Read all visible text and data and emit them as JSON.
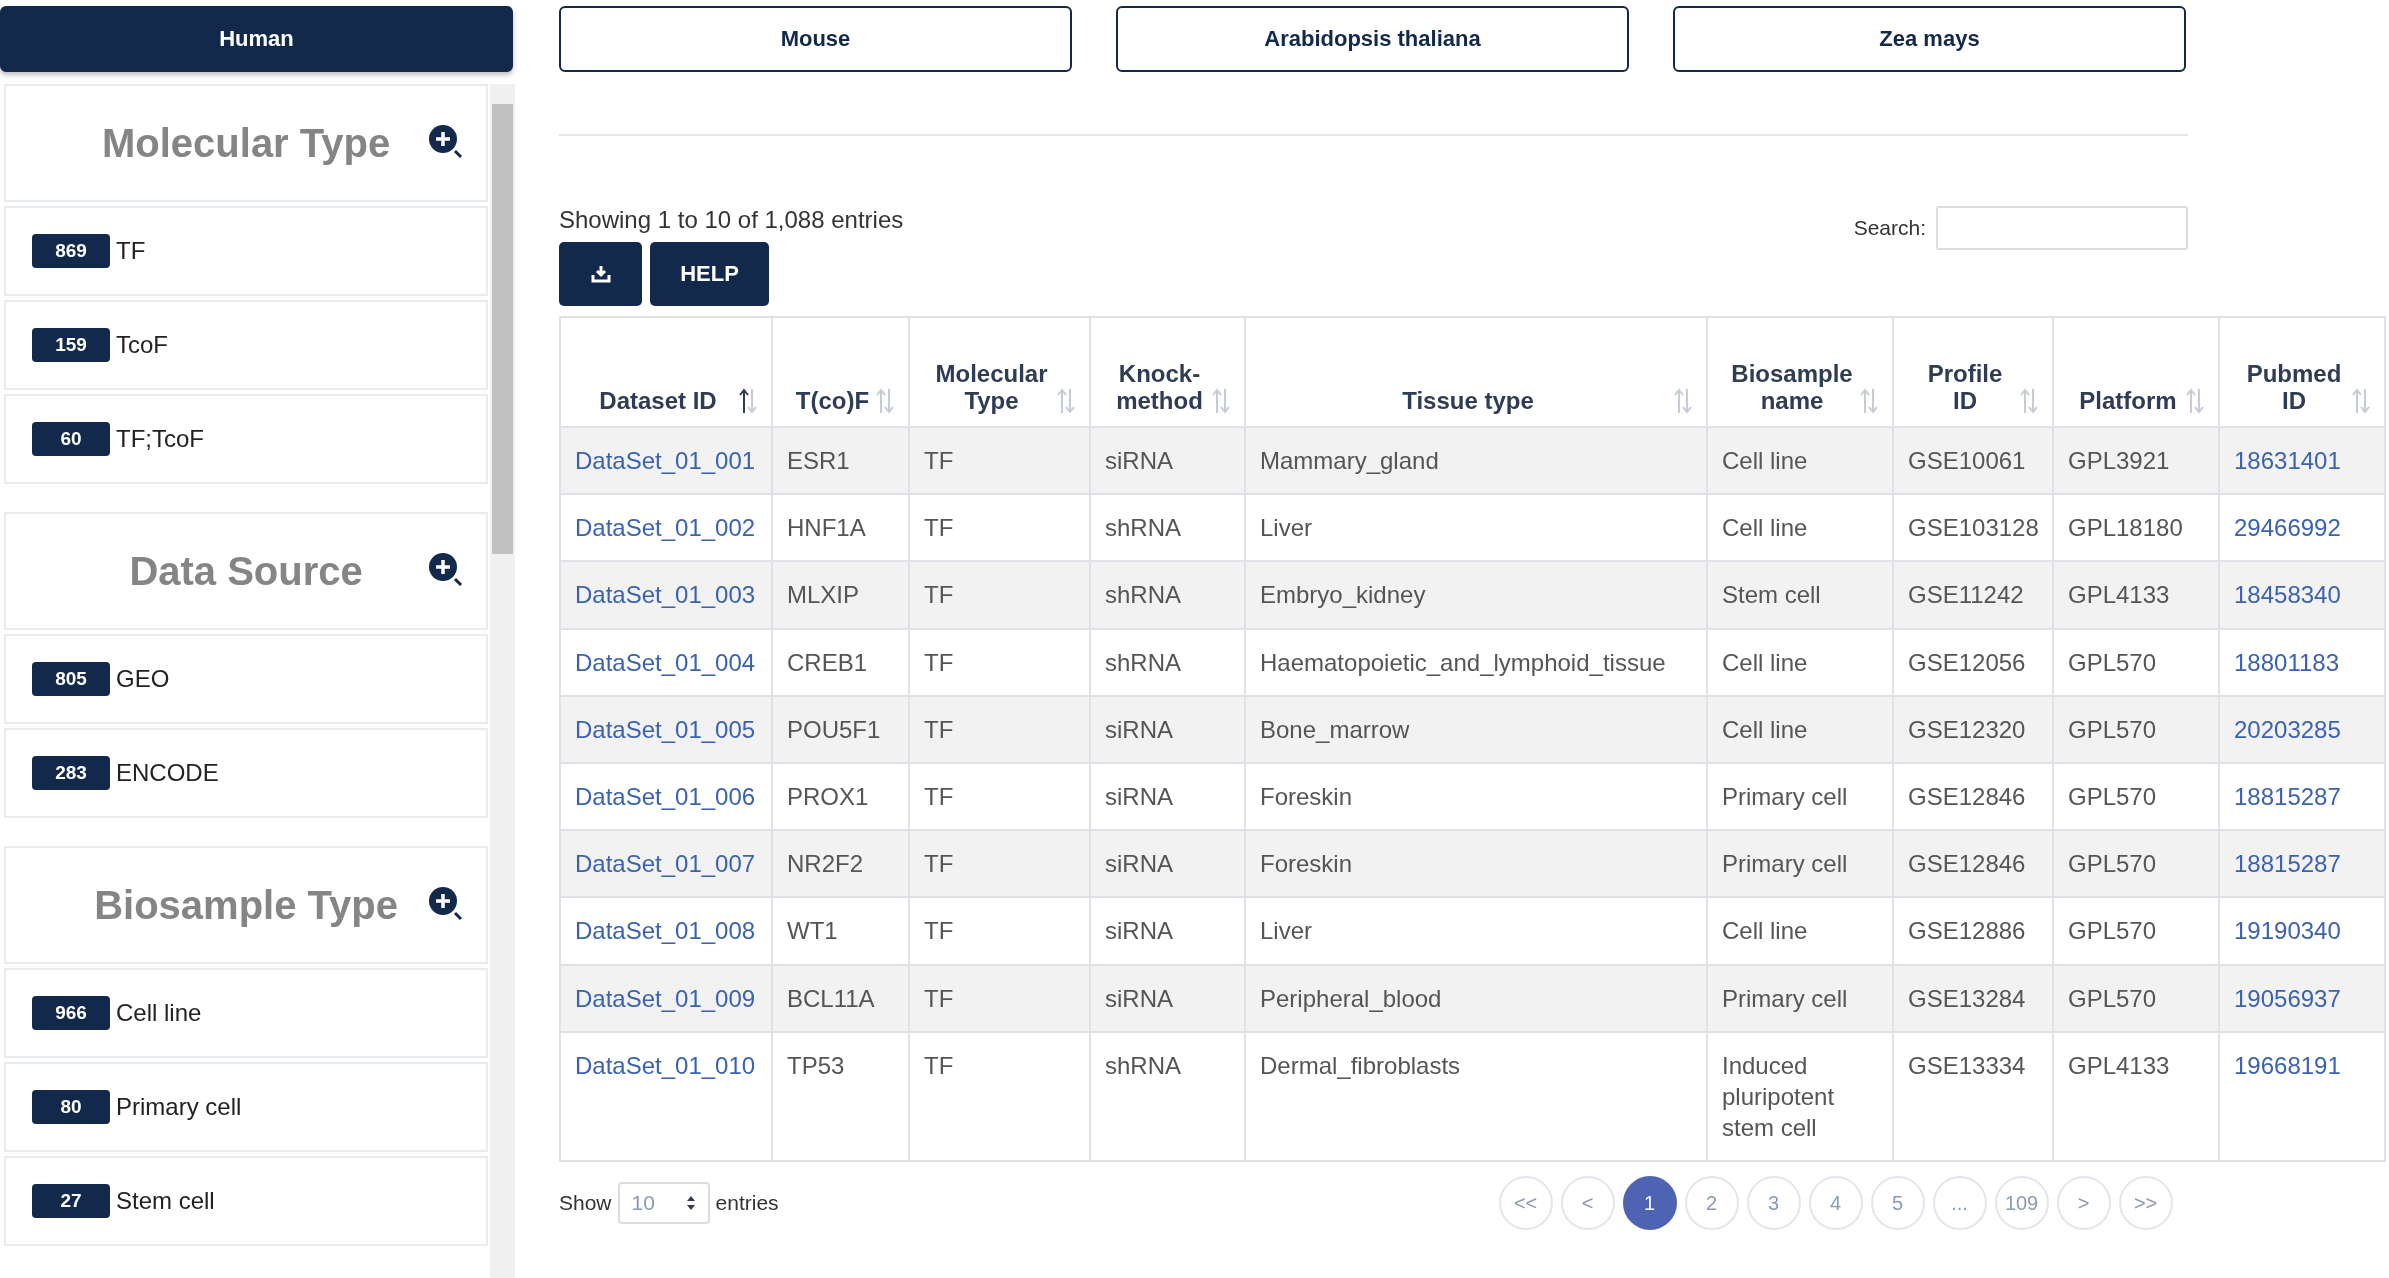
{
  "species_tabs": [
    {
      "label": "Human",
      "selected": true
    },
    {
      "label": "Mouse",
      "selected": false
    },
    {
      "label": "Arabidopsis thaliana",
      "selected": false
    },
    {
      "label": "Zea mays",
      "selected": false
    }
  ],
  "filters": [
    {
      "title": "Molecular Type",
      "items": [
        {
          "count": "869",
          "label": "TF"
        },
        {
          "count": "159",
          "label": "TcoF"
        },
        {
          "count": "60",
          "label": "TF;TcoF"
        }
      ]
    },
    {
      "title": "Data Source",
      "items": [
        {
          "count": "805",
          "label": "GEO"
        },
        {
          "count": "283",
          "label": "ENCODE"
        }
      ]
    },
    {
      "title": "Biosample Type",
      "items": [
        {
          "count": "966",
          "label": "Cell line"
        },
        {
          "count": "80",
          "label": "Primary cell"
        },
        {
          "count": "27",
          "label": "Stem cell"
        }
      ]
    }
  ],
  "info": "Showing 1 to 10 of 1,088 entries",
  "help_button": "HELP",
  "search": {
    "label": "Search:"
  },
  "table": {
    "columns": [
      {
        "label": "Dataset ID",
        "sorted": true
      },
      {
        "label": "T(co)F",
        "sorted": false
      },
      {
        "label": "Molecular Type",
        "sorted": false
      },
      {
        "label": "Knock-method",
        "sorted": false
      },
      {
        "label": "Tissue type",
        "sorted": false
      },
      {
        "label": "Biosample name",
        "sorted": false
      },
      {
        "label": "Profile ID",
        "sorted": false
      },
      {
        "label": "Platform",
        "sorted": false
      },
      {
        "label": "Pubmed ID",
        "sorted": false
      }
    ],
    "rows": [
      [
        "DataSet_01_001",
        "ESR1",
        "TF",
        "siRNA",
        "Mammary_gland",
        "Cell line",
        "GSE10061",
        "GPL3921",
        "18631401"
      ],
      [
        "DataSet_01_002",
        "HNF1A",
        "TF",
        "shRNA",
        "Liver",
        "Cell line",
        "GSE103128",
        "GPL18180",
        "29466992"
      ],
      [
        "DataSet_01_003",
        "MLXIP",
        "TF",
        "shRNA",
        "Embryo_kidney",
        "Stem cell",
        "GSE11242",
        "GPL4133",
        "18458340"
      ],
      [
        "DataSet_01_004",
        "CREB1",
        "TF",
        "shRNA",
        "Haematopoietic_and_lymphoid_tissue",
        "Cell line",
        "GSE12056",
        "GPL570",
        "18801183"
      ],
      [
        "DataSet_01_005",
        "POU5F1",
        "TF",
        "siRNA",
        "Bone_marrow",
        "Cell line",
        "GSE12320",
        "GPL570",
        "20203285"
      ],
      [
        "DataSet_01_006",
        "PROX1",
        "TF",
        "siRNA",
        "Foreskin",
        "Primary cell",
        "GSE12846",
        "GPL570",
        "18815287"
      ],
      [
        "DataSet_01_007",
        "NR2F2",
        "TF",
        "siRNA",
        "Foreskin",
        "Primary cell",
        "GSE12846",
        "GPL570",
        "18815287"
      ],
      [
        "DataSet_01_008",
        "WT1",
        "TF",
        "siRNA",
        "Liver",
        "Cell line",
        "GSE12886",
        "GPL570",
        "19190340"
      ],
      [
        "DataSet_01_009",
        "BCL11A",
        "TF",
        "siRNA",
        "Peripheral_blood",
        "Primary cell",
        "GSE13284",
        "GPL570",
        "19056937"
      ],
      [
        "DataSet_01_010",
        "TP53",
        "TF",
        "shRNA",
        "Dermal_fibroblasts",
        "Induced pluripotent stem cell",
        "GSE13334",
        "GPL4133",
        "19668191"
      ]
    ]
  },
  "length": {
    "before": "Show",
    "value": "10",
    "after": "entries"
  },
  "pagination": [
    {
      "label": "<<",
      "selected": false
    },
    {
      "label": "<",
      "selected": false
    },
    {
      "label": "1",
      "selected": true
    },
    {
      "label": "2",
      "selected": false
    },
    {
      "label": "3",
      "selected": false
    },
    {
      "label": "4",
      "selected": false
    },
    {
      "label": "5",
      "selected": false
    },
    {
      "label": "...",
      "selected": false
    },
    {
      "label": "109",
      "selected": false
    },
    {
      "label": ">",
      "selected": false
    },
    {
      "label": ">>",
      "selected": false
    }
  ]
}
